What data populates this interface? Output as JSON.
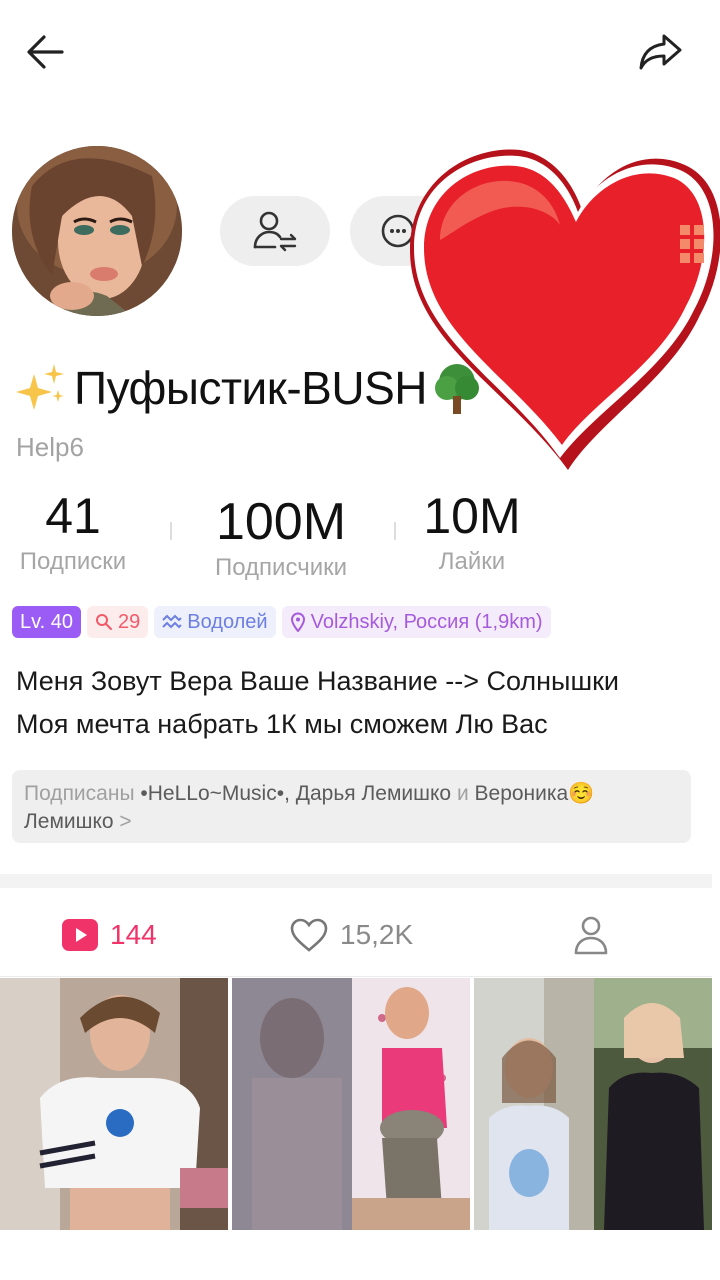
{
  "profile": {
    "name": "Пуфыстик-BUSH",
    "handle": "Help6",
    "bio_line1": "Меня Зовут Вера Ваше Название --> Солнышки",
    "bio_line2": "Моя мечта набрать 1К мы сможем Лю Вас"
  },
  "stats": [
    {
      "value": "41",
      "label": "Подписки"
    },
    {
      "value": "100M",
      "label": "Подписчики"
    },
    {
      "value": "10M",
      "label": "Лайки"
    }
  ],
  "tags": {
    "level": "Lv. 40",
    "age": "29",
    "zodiac": "Водолей",
    "location": "Volzhskiy, Россия (1,9km)"
  },
  "followed": {
    "prefix": "Подписаны",
    "user1": "•HeLLo~Music•",
    "sep": ",",
    "user2": "Дарья Лемишко",
    "and": "и",
    "user3": "Вероника☺️",
    "user3b": "Лемишко",
    "more": ">"
  },
  "tabs": {
    "videos_count": "144",
    "likes_count": "15,2K"
  },
  "icons": [
    "back-arrow-icon",
    "share-icon",
    "friend-request-icon",
    "message-icon",
    "heart-sticker",
    "sparkles-icon",
    "tree-icon",
    "search-icon",
    "aquarius-icon",
    "location-pin-icon",
    "play-icon",
    "heart-outline-icon",
    "person-icon"
  ],
  "colors": {
    "accent": "#f0346a",
    "level": "#9b5cf5",
    "heart": "#e8202a"
  }
}
